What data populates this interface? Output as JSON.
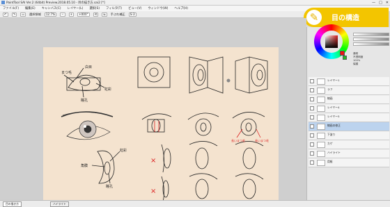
{
  "window": {
    "title": "PaintTool SAI Ver.2 (64bit) Preview.2018.05.10 - 目の描き方.sai2 [*]",
    "controls": [
      "—",
      "□",
      "✕"
    ]
  },
  "menu": [
    "ファイル(F)",
    "編集(E)",
    "キャンバス(C)",
    "レイヤー(L)",
    "選択(S)",
    "フィルタ(T)",
    "ビュー(V)",
    "ウィンドウ(W)",
    "ヘルプ(H)"
  ],
  "toolbar": {
    "selection_label": "選択領域",
    "zoom": "12.7%",
    "angle": "+000°",
    "stabilizer_label": "手ぶれ補正",
    "stabilizer_value": "S-3"
  },
  "badge": {
    "icon": "✎",
    "text": "目の構造"
  },
  "canvas": {
    "labels": {
      "sclera": "白目",
      "lashes": "まつ毛",
      "iris": "虹彩",
      "pupil": "瞳孔",
      "iris2": "虹彩",
      "cornea": "角膜",
      "pupil2": "瞳孔",
      "note_left": "長いまつ毛",
      "note_right": "長いまつ毛",
      "x1": "×",
      "x2": "×"
    }
  },
  "panel": {
    "property_labels": [
      "通常",
      "不透明度",
      "100%",
      "保護"
    ],
    "layers": [
      "レイヤー1",
      "ラフ",
      "線画",
      "レイヤー4",
      "レイヤー5",
      "線画の修正",
      "下塗り",
      "カゲ",
      "ハイライト",
      "用紙"
    ],
    "selected_layer": 5
  },
  "status": {
    "tabs": [
      "目の描き方",
      "ハイライト"
    ]
  }
}
